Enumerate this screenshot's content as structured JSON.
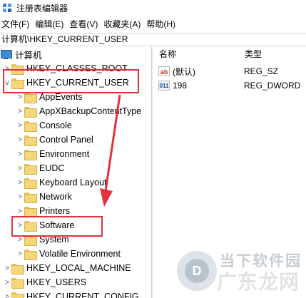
{
  "window": {
    "title": "注册表编辑器"
  },
  "menu": {
    "items": [
      "文件(F)",
      "编辑(E)",
      "查看(V)",
      "收藏夹(A)",
      "帮助(H)"
    ]
  },
  "address": {
    "path": "计算机\\HKEY_CURRENT_USER"
  },
  "tree": {
    "root": "计算机",
    "items": [
      {
        "label": "HKEY_CLASSES_ROOT",
        "expander": ">"
      },
      {
        "label": "HKEY_CURRENT_USER",
        "expander": "v"
      },
      {
        "label": "AppEvents",
        "expander": ">"
      },
      {
        "label": "AppXBackupContentType",
        "expander": ">"
      },
      {
        "label": "Console",
        "expander": ">"
      },
      {
        "label": "Control Panel",
        "expander": ">"
      },
      {
        "label": "Environment",
        "expander": ">"
      },
      {
        "label": "EUDC",
        "expander": ">"
      },
      {
        "label": "Keyboard Layout",
        "expander": ">"
      },
      {
        "label": "Network",
        "expander": ">"
      },
      {
        "label": "Printers",
        "expander": ">"
      },
      {
        "label": "Software",
        "expander": ">"
      },
      {
        "label": "System",
        "expander": ">"
      },
      {
        "label": "Volatile Environment",
        "expander": ">"
      },
      {
        "label": "HKEY_LOCAL_MACHINE",
        "expander": ">"
      },
      {
        "label": "HKEY_USERS",
        "expander": ">"
      },
      {
        "label": "HKEY_CURRENT_CONFIG",
        "expander": ">"
      }
    ]
  },
  "values_pane": {
    "columns": {
      "name": "名称",
      "type": "类型"
    },
    "rows": [
      {
        "icon": "ab",
        "name": "(默认)",
        "type": "REG_SZ"
      },
      {
        "icon": "binary",
        "name": "198",
        "type": "REG_DWORD"
      }
    ]
  },
  "annotations": {
    "color": "#e0333c"
  },
  "watermark": {
    "line1": "当下软件园",
    "line2": "广东龙网"
  }
}
